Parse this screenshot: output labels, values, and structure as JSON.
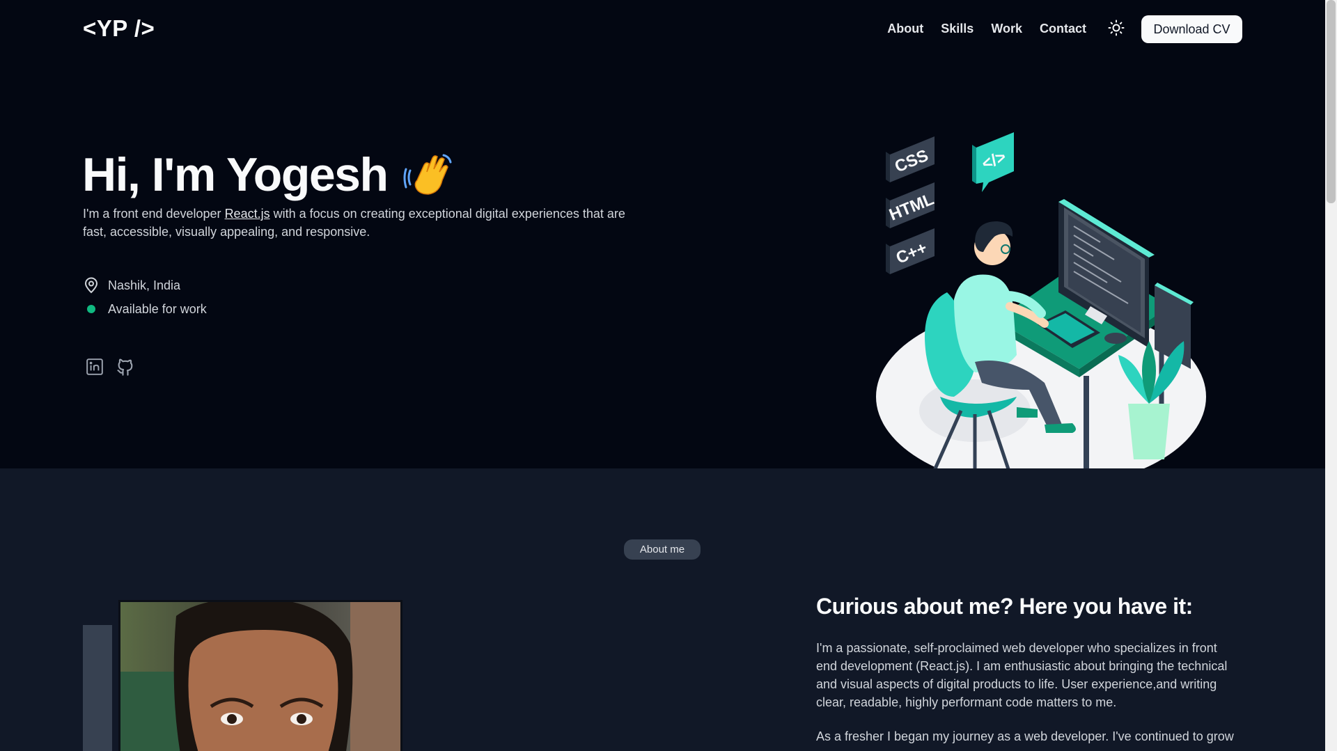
{
  "header": {
    "logo": "<YP />",
    "nav": [
      "About",
      "Skills",
      "Work",
      "Contact"
    ],
    "theme_icon": "sun-icon",
    "cv_button": "Download CV"
  },
  "hero": {
    "title": "Hi, I'm Yogesh",
    "emoji_icon": "waving-hand-icon",
    "desc_before": "I'm a front end developer ",
    "desc_link": "React.js",
    "desc_after": " with a focus on creating exceptional digital experiences that are fast, accessible, visually appealing, and responsive.",
    "location": "Nashik, India",
    "availability": "Available for work",
    "socials": [
      "linkedin-icon",
      "github-icon"
    ],
    "illustration": {
      "tags": [
        "CSS",
        "HTML",
        "C++"
      ]
    }
  },
  "about": {
    "badge": "About me",
    "title": "Curious about me? Here you have it:",
    "p1": "I'm a passionate, self-proclaimed web developer who specializes in front end development (React.js). I am enthusiastic about bringing the technical and visual aspects of digital products to life. User experience,and writing clear, readable, highly performant code matters to me.",
    "p2": "As a fresher I began my journey as a web developer. I've continued to grow"
  },
  "colors": {
    "bg_dark": "#030712",
    "bg_section": "#111827",
    "accent": "#10b981",
    "illustration_teal": "#2dd4bf"
  }
}
